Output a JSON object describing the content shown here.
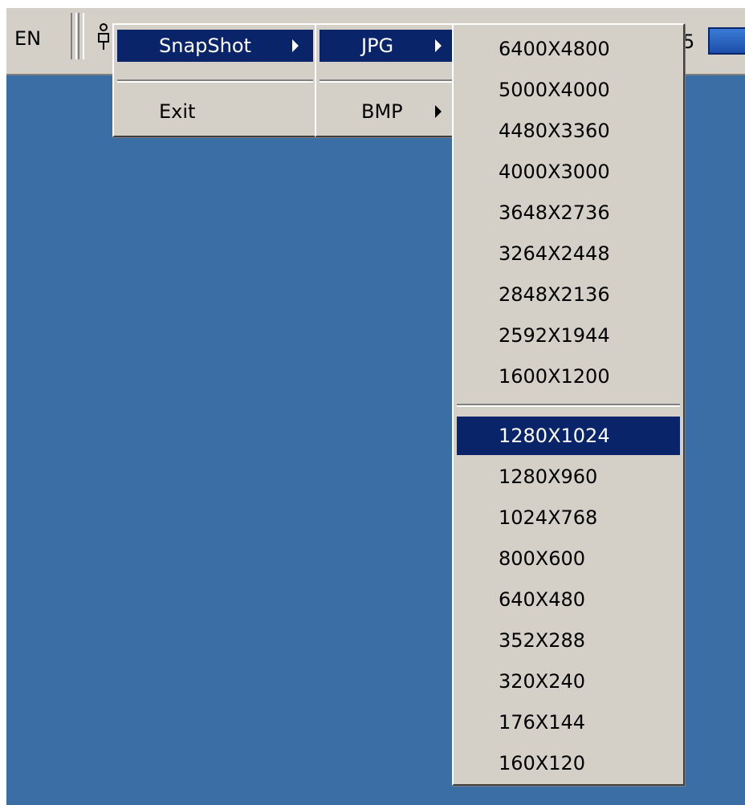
{
  "taskbar": {
    "language": "EN",
    "tray_digit": "5",
    "icons": [
      "usb-camera-icon",
      "monitor-icon"
    ]
  },
  "menu1": {
    "items": [
      {
        "label": "SnapShot",
        "submenu": true,
        "highlighted": true
      },
      {
        "label": "Exit",
        "submenu": false,
        "highlighted": false
      }
    ]
  },
  "menu2": {
    "items": [
      {
        "label": "JPG",
        "submenu": true,
        "highlighted": true
      },
      {
        "label": "BMP",
        "submenu": true,
        "highlighted": false
      }
    ]
  },
  "menu3": {
    "group1": [
      "6400X4800",
      "5000X4000",
      "4480X3360",
      "4000X3000",
      "3648X2736",
      "3264X2448",
      "2848X2136",
      "2592X1944",
      "1600X1200"
    ],
    "group2": [
      "1280X1024",
      "1280X960",
      "1024X768",
      "800X600",
      "640X480",
      "352X288",
      "320X240",
      "176X144",
      "160X120"
    ],
    "selected": "1280X1024"
  },
  "colors": {
    "desktop": "#3a6ea5",
    "menu_bg": "#d4d0c8",
    "highlight": "#0a246a"
  }
}
